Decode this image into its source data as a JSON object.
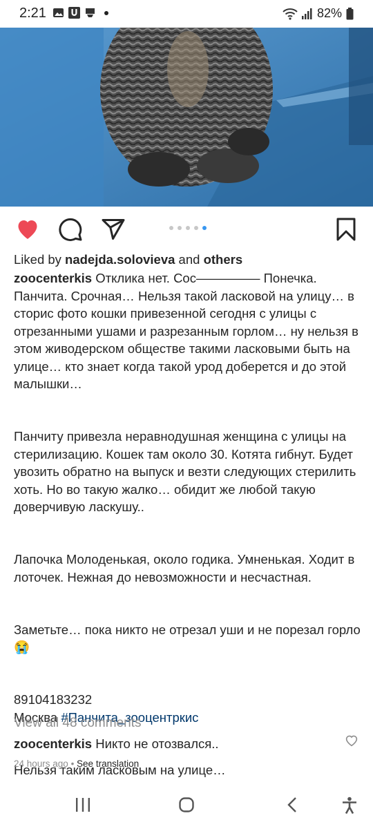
{
  "status_bar": {
    "time": "2:21",
    "battery": "82%",
    "icons": [
      "gallery-icon",
      "u-app-icon",
      "sim-icon",
      "dot-icon",
      "wifi-icon",
      "signal-icon",
      "battery-icon"
    ]
  },
  "post": {
    "carousel": {
      "count": 5,
      "active": 5
    },
    "likes": {
      "prefix": "Liked by ",
      "user": "nadejda.solovieva",
      "middle": " and ",
      "others": "others"
    },
    "caption": {
      "author": "zoocenterkis",
      "p1": "Отклика нет. Сос————— Понечка. Панчита. Срочная… Нельзя такой ласковой на улицу… в сторис фото кошки привезенной сегодня с улицы с отрезанными ушами и разрезанным горлом… ну нельзя в этом живодерском обществе такими ласковыми быть на улице… кто знает когда такой урод доберется и до этой малышки…",
      "p2": "Панчиту привезла неравнодушная женщина с улицы на стерилизацию. Кошек там около 30. Котята гибнут. Будет увозить обратно на выпуск и везти следующих стерилить хоть. Но во такую жалко… обидит же любой такую доверчивую ласкушу..",
      "p3": "Лапочка Молоденькая, около годика. Умненькая. Ходит в лоточек. Нежная до невозможности и несчастная.",
      "p4": "Заметьте… пока никто не отрезал уши и не порезал горло😭",
      "phone": "89104183232",
      "city": "Москва ",
      "hashtag": "#Панчита_зооцентркис",
      "p5": "Нельзя таким ласковым на улице…"
    },
    "view_all": "View all 48 comments",
    "comment": {
      "author": "zoocenterkis",
      "text": "Никто не отозвался.."
    },
    "time_ago": "24 hours ago",
    "separator": " • ",
    "see_translation": "See translation"
  },
  "colors": {
    "like_red": "#ed4956",
    "hashtag": "#00376b",
    "dot_active": "#3897f0"
  }
}
